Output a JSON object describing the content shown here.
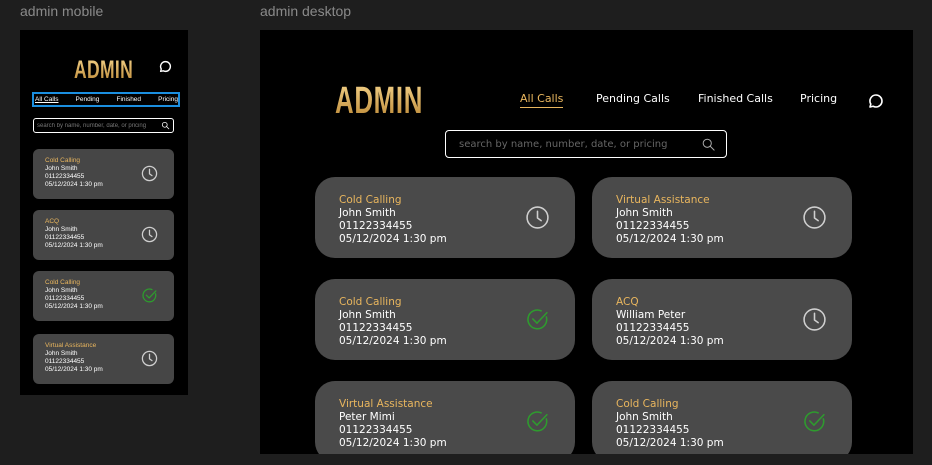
{
  "frames": {
    "mobile_label": "admin mobile",
    "desktop_label": "admin desktop"
  },
  "app": {
    "logo": "ADMIN"
  },
  "nav": {
    "mobile": [
      "All Calls",
      "Pending",
      "Finished",
      "Pricing"
    ],
    "desktop": [
      "All Calls",
      "Pending Calls",
      "Finished Calls",
      "Pricing"
    ],
    "active_index": 0
  },
  "search": {
    "placeholder_mobile": "search by name, number, date, or pricing",
    "placeholder_desktop": "search by name, number, date, or pricing"
  },
  "colors": {
    "accent": "#e9b65e",
    "card": "#4a4a4a",
    "done": "#2e9b2e",
    "pending": "#cfcfcf",
    "selection": "#1b8fe0"
  },
  "mobile_cards": [
    {
      "category": "Cold Calling",
      "name": "John Smith",
      "phone": "01122334455",
      "datetime": "05/12/2024 1:30 pm",
      "status": "pending",
      "icon": "clock-icon"
    },
    {
      "category": "ACQ",
      "name": "John Smith",
      "phone": "01122334455",
      "datetime": "05/12/2024 1:30 pm",
      "status": "pending",
      "icon": "clock-icon"
    },
    {
      "category": "Cold Calling",
      "name": "John Smith",
      "phone": "01122334455",
      "datetime": "05/12/2024 1:30 pm",
      "status": "finished",
      "icon": "check-circle-icon"
    },
    {
      "category": "Virtual Assistance",
      "name": "John Smith",
      "phone": "01122334455",
      "datetime": "05/12/2024 1:30 pm",
      "status": "pending",
      "icon": "clock-icon"
    }
  ],
  "desktop_cards": [
    {
      "category": "Cold Calling",
      "name": "John Smith",
      "phone": "01122334455",
      "datetime": "05/12/2024 1:30 pm",
      "status": "pending",
      "icon": "clock-icon"
    },
    {
      "category": "Virtual Assistance",
      "name": "John Smith",
      "phone": "01122334455",
      "datetime": "05/12/2024 1:30 pm",
      "status": "pending",
      "icon": "clock-icon"
    },
    {
      "category": "Cold Calling",
      "name": "John Smith",
      "phone": "01122334455",
      "datetime": "05/12/2024 1:30 pm",
      "status": "finished",
      "icon": "check-circle-icon"
    },
    {
      "category": "ACQ",
      "name": "William Peter",
      "phone": "01122334455",
      "datetime": "05/12/2024 1:30 pm",
      "status": "pending",
      "icon": "clock-icon"
    },
    {
      "category": "Virtual Assistance",
      "name": "Peter Mimi",
      "phone": "01122334455",
      "datetime": "05/12/2024 1:30 pm",
      "status": "finished",
      "icon": "check-circle-icon"
    },
    {
      "category": "Cold Calling",
      "name": "John Smith",
      "phone": "01122334455",
      "datetime": "05/12/2024 1:30 pm",
      "status": "finished",
      "icon": "check-circle-icon"
    }
  ]
}
